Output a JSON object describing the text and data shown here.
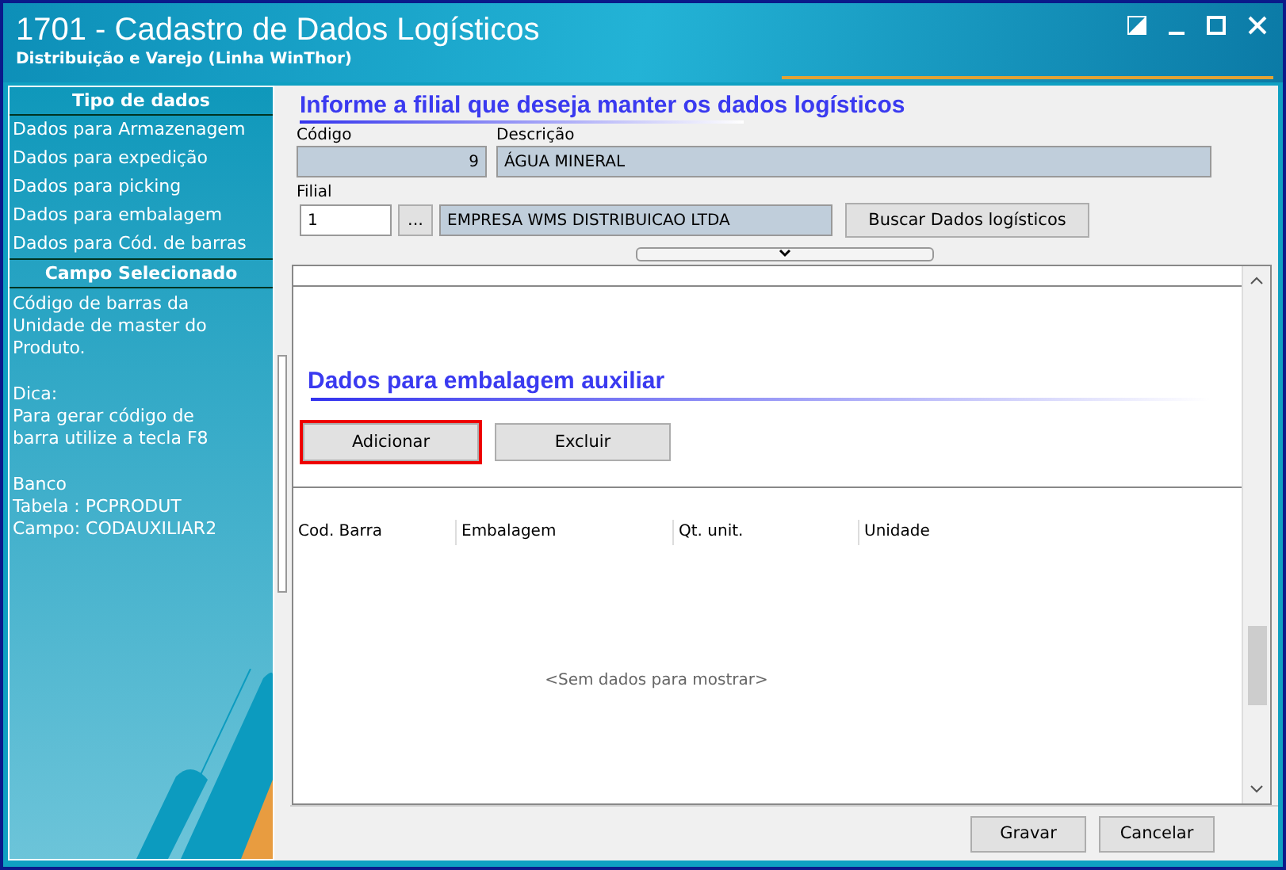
{
  "window": {
    "title": "1701 - Cadastro de Dados Logísticos",
    "subtitle": "Distribuição e Varejo (Linha WinThor)"
  },
  "sidebar": {
    "sections": [
      {
        "title": "Tipo de dados",
        "items": [
          "Dados para Armazenagem",
          "Dados para expedição",
          "Dados para picking",
          "Dados para embalagem",
          "Dados para Cód. de barras"
        ]
      },
      {
        "title": "Campo Selecionado",
        "paragraphs": [
          "Código de barras da\nUnidade de master do\nProduto.",
          "Dica:\nPara gerar código de\nbarra utilize a tecla F8",
          "Banco\nTabela : PCPRODUT\nCampo: CODAUXILIAR2"
        ]
      }
    ]
  },
  "header": {
    "title": "Informe a filial que deseja manter os dados logísticos",
    "codigo": {
      "label": "Código",
      "value": "9"
    },
    "descricao": {
      "label": "Descrição",
      "value": "ÁGUA MINERAL"
    },
    "filial": {
      "label": "Filial",
      "value": "1",
      "lookup_button": "...",
      "name": "EMPRESA WMS DISTRIBUICAO LTDA"
    },
    "search_button": "Buscar Dados logísticos"
  },
  "section": {
    "title": "Dados para embalagem auxiliar",
    "buttons": [
      {
        "label": "Adicionar",
        "highlighted": true
      },
      {
        "label": "Excluir",
        "highlighted": false
      }
    ],
    "table": {
      "columns": [
        "Cod. Barra",
        "Embalagem",
        "Qt. unit.",
        "Unidade"
      ],
      "empty_text": "<Sem dados para mostrar>"
    }
  },
  "footer": {
    "buttons": [
      "Gravar",
      "Cancelar"
    ]
  }
}
